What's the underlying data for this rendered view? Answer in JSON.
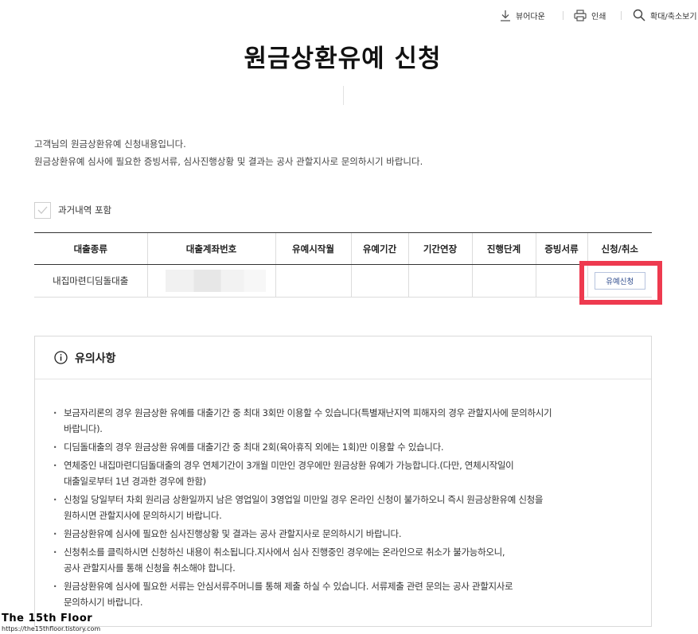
{
  "toolbar": {
    "viewer_label": "뷰어다운",
    "print_label": "인쇄",
    "zoom_label": "확대/축소보기"
  },
  "page": {
    "title": "원금상환유예 신청"
  },
  "intro": {
    "line1": "고객님의 원금상환유예 신청내용입니다.",
    "line2": "원금상환유예 심사에 필요한 증빙서류, 심사진행상황 및 결과는 공사 관할지사로 문의하시기 바랍니다."
  },
  "history": {
    "label": "과거내역 포함",
    "checked": false
  },
  "table": {
    "headers": [
      "대출종류",
      "대출계좌번호",
      "유예시작월",
      "유예기간",
      "기간연장",
      "진행단계",
      "증빙서류",
      "신청/취소"
    ],
    "rows": [
      {
        "loan_type": "내집마련디딤돌대출",
        "account": "",
        "start_month": "",
        "period": "",
        "extension": "",
        "stage": "",
        "documents": "",
        "action_label": "유예신청"
      }
    ]
  },
  "notice": {
    "title": "유의사항",
    "items": [
      [
        "보금자리론의 경우 원금상환 유예를 대출기간 중 최대 3회만 이용할 수 있습니다(특별재난지역 피해자의 경우 관할지사에 문의하시기",
        "바랍니다)."
      ],
      [
        "디딤돌대출의 경우 원금상환 유예를 대출기간 중 최대 2회(육아휴직 외에는 1회)만 이용할 수 있습니다."
      ],
      [
        "연체중인 내집마련디딤돌대출의 경우 연체기간이 3개월 미만인 경우에만 원금상환 유예가 가능합니다.(다만, 연체시작일이",
        "대출일로부터 1년 경과한 경우에 한함)"
      ],
      [
        "신청일 당일부터 차회 원리금 상환일까지 남은 영업일이 3영업일 미만일 경우 온라인 신청이 불가하오니 즉시 원금상환유예 신청을",
        "원하시면 관할지사에 문의하시기 바랍니다."
      ],
      [
        "원금상환유예 심사에 필요한 심사진행상황 및 결과는 공사 관할지사로 문의하시기 바랍니다."
      ],
      [
        "신청취소를 클릭하시면 신청하신 내용이 취소됩니다.지사에서 심사 진행중인 경우에는 온라인으로 취소가 불가능하오니,",
        "공사 관할지사를 통해 신청을 취소해야 합니다."
      ],
      [
        "원금상환유예 심사에 필요한 서류는 안심서류주머니를 통해 제출 하실 수 있습니다. 서류제출 관련 문의는 공사 관할지사로",
        "문의하시기 바랍니다."
      ]
    ]
  },
  "watermark": {
    "title": "The 15th Floor",
    "url": "https://the15thfloor.tistory.com"
  },
  "colors": {
    "highlight": "#ee3a4f",
    "button_text": "#2c4a8c"
  }
}
